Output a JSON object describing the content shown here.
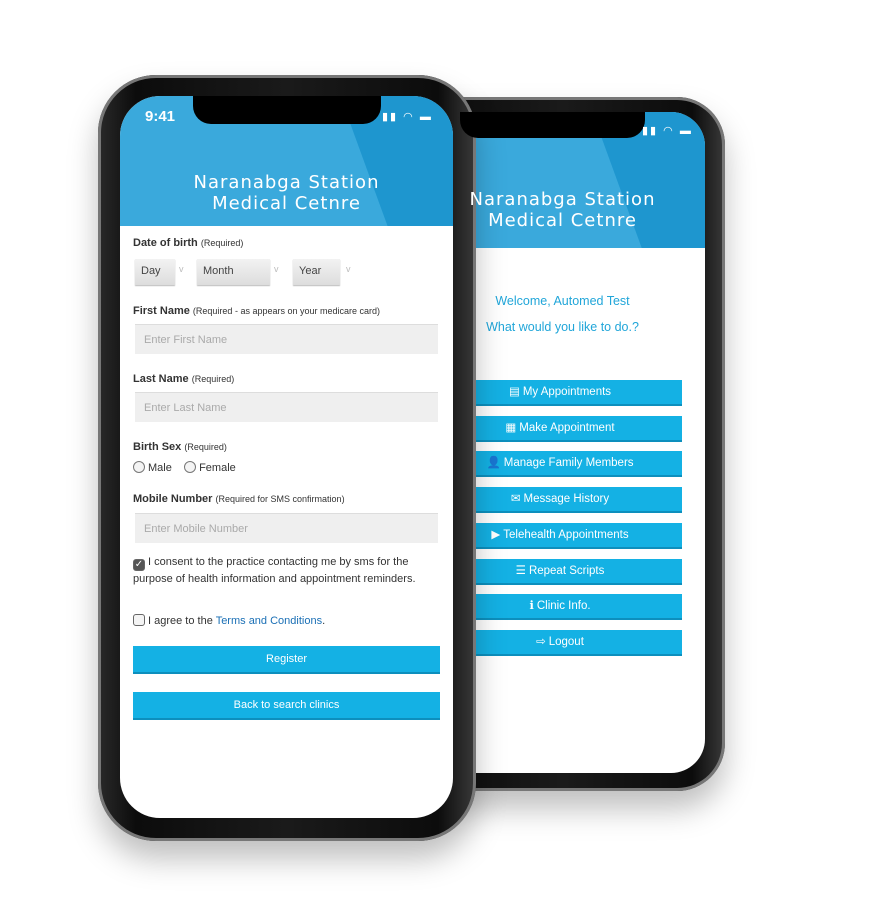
{
  "clinic_title": [
    "Naranabga Station",
    "Medical Cetnre"
  ],
  "status_time": "9:41",
  "registration": {
    "dob_label": "Date of birth",
    "dob_note": "(Required)",
    "dob_selects": [
      "Day",
      "Month",
      "Year"
    ],
    "first_name_label": "First Name",
    "first_name_note": "(Required - as appears on your medicare card)",
    "first_name_placeholder": "Enter First Name",
    "last_name_label": "Last Name",
    "last_name_note": "(Required)",
    "last_name_placeholder": "Enter Last Name",
    "sex_label": "Birth Sex",
    "sex_note": "(Required)",
    "sex_options": [
      "Male",
      "Female"
    ],
    "mobile_label": "Mobile Number",
    "mobile_note": "(Required for SMS confirmation)",
    "mobile_placeholder": "Enter Mobile Number",
    "consent_text": "I consent to the practice contacting me by sms for the purpose of health information and appointment reminders.",
    "consent_checked": true,
    "terms_prefix": "I agree to the ",
    "terms_link": "Terms and Conditions",
    "terms_suffix": ".",
    "terms_checked": false,
    "register_label": "Register",
    "back_label": "Back to search clinics"
  },
  "dashboard": {
    "welcome": "Welcome, Automed Test",
    "prompt": "What would you like to do.?",
    "menu": [
      {
        "icon": "list-icon",
        "glyph": "▤",
        "label": "My Appointments"
      },
      {
        "icon": "calendar-icon",
        "glyph": "▦",
        "label": "Make Appointment"
      },
      {
        "icon": "user-icon",
        "glyph": "👤",
        "label": "Manage Family Members"
      },
      {
        "icon": "envelope-icon",
        "glyph": "✉",
        "label": "Message History"
      },
      {
        "icon": "video-camera-icon",
        "glyph": "▶",
        "label": "Telehealth Appointments"
      },
      {
        "icon": "tasks-icon",
        "glyph": "☰",
        "label": "Repeat Scripts"
      },
      {
        "icon": "info-icon",
        "glyph": "ℹ",
        "label": "Clinic Info."
      },
      {
        "icon": "logout-icon",
        "glyph": "⇨",
        "label": "Logout"
      }
    ]
  },
  "colors": {
    "header": "#3aa9dc",
    "button": "#14b1e4",
    "welcome_text": "#21a6d9",
    "link": "#1a6fb5"
  }
}
